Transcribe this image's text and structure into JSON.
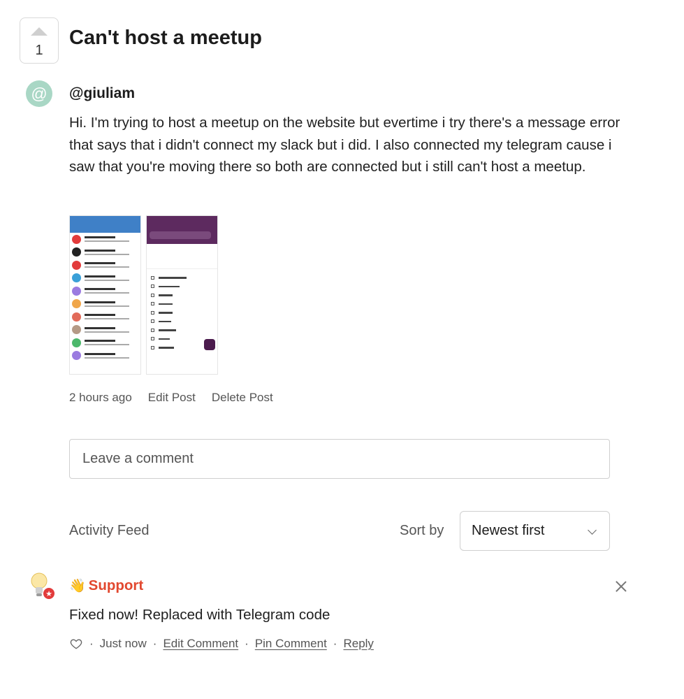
{
  "post": {
    "vote_count": "1",
    "title": "Can't host a meetup",
    "avatar_glyph": "@",
    "author": "@giuliam",
    "body": "Hi. I'm trying to host a meetup on the website but evertime i try there's a message error that says that i didn't connect my slack but i did. I also connected my telegram cause i saw that you're moving there so both are connected but i still can't host a meetup.",
    "time": "2 hours ago",
    "edit_label": "Edit Post",
    "delete_label": "Delete Post"
  },
  "attachments": [
    "telegram-screenshot",
    "slack-screenshot"
  ],
  "comment_box": {
    "placeholder": "Leave a comment"
  },
  "feed": {
    "label": "Activity Feed",
    "sort_label": "Sort by",
    "sort_value": "Newest first"
  },
  "comments": [
    {
      "author_emoji": "👋",
      "author": "Support",
      "body": "Fixed now! Replaced with Telegram code",
      "time": "Just now",
      "edit_label": "Edit Comment",
      "pin_label": "Pin Comment",
      "reply_label": "Reply",
      "sep": "·"
    }
  ],
  "colors": {
    "accent": "#e2482f",
    "avatar": "#a9d7c5",
    "border": "#cfcfcf"
  },
  "icons": [
    "upvote-arrow-icon",
    "at-avatar-icon",
    "chevron-down-icon",
    "lightbulb-icon",
    "close-icon",
    "heart-icon",
    "waving-hand-icon"
  ]
}
